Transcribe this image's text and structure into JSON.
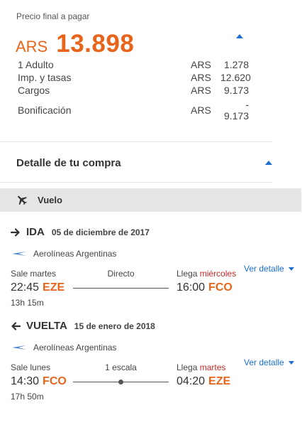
{
  "price": {
    "label": "Precio final a pagar",
    "currency": "ARS",
    "total": "13.898",
    "breakdown": [
      {
        "label": "1 Adulto",
        "currency": "ARS",
        "amount": "1.278"
      },
      {
        "label": "Imp. y tasas",
        "currency": "ARS",
        "amount": "12.620"
      },
      {
        "label": "Cargos",
        "currency": "ARS",
        "amount": "9.173"
      },
      {
        "label": "Bonificación",
        "currency": "ARS",
        "amount": "- 9.173"
      }
    ]
  },
  "detail": {
    "title": "Detalle de tu compra"
  },
  "flight_section": {
    "label": "Vuelo"
  },
  "legs": [
    {
      "direction": "IDA",
      "date": "05 de diciembre de 2017",
      "airline": "Aerolíneas Argentinas",
      "view_details": "Ver detalle",
      "depart_label": "Sale martes",
      "stops_label": "Directo",
      "arrive_label": "Llega",
      "arrive_day": "miércoles",
      "depart_time": "22:45",
      "depart_code": "EZE",
      "arrive_time": "16:00",
      "arrive_code": "FCO",
      "duration": "13h 15m"
    },
    {
      "direction": "VUELTA",
      "date": "15 de enero de 2018",
      "airline": "Aerolíneas Argentinas",
      "view_details": "Ver detalle",
      "depart_label": "Sale lunes",
      "stops_label": "1 escala",
      "arrive_label": "Llega",
      "arrive_day": "martes",
      "depart_time": "14:30",
      "depart_code": "FCO",
      "arrive_time": "04:20",
      "arrive_code": "EZE",
      "duration": "17h 50m"
    }
  ],
  "icons": {
    "price_toggle": "caret-up-icon",
    "detail_toggle": "caret-up-icon",
    "section": "plane-icon",
    "outbound": "arrow-right-icon",
    "return": "arrow-left-icon",
    "airline": "airline-logo-icon",
    "view_details": "caret-down-icon"
  },
  "colors": {
    "accent_orange": "#e8641b",
    "link_blue": "#1b6fd3",
    "highlight_red": "#c62828",
    "section_bg": "#e6e6e6"
  }
}
